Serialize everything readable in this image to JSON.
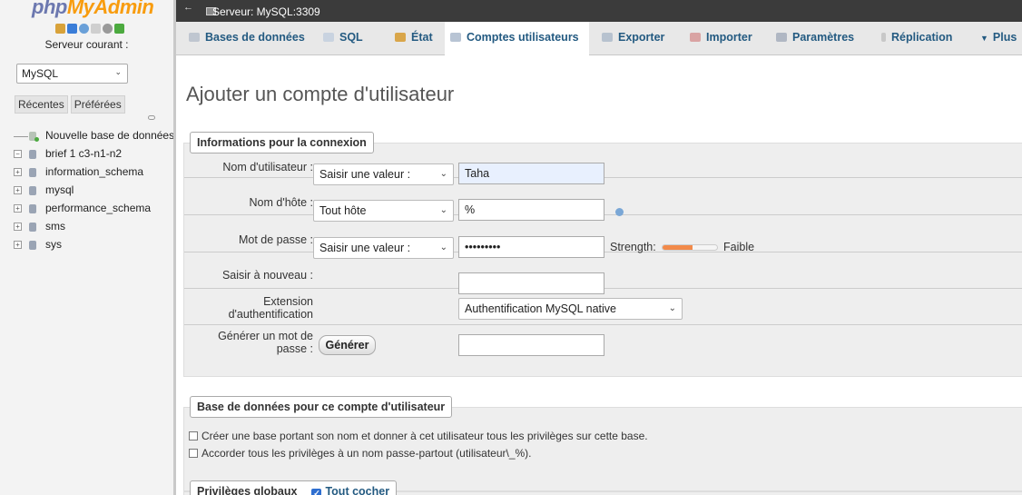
{
  "sidebar": {
    "logo_php": "php",
    "logo_myadmin": "MyAdmin",
    "server_label": "Serveur courant :",
    "server_value": "MySQL",
    "recent_tab": "Récentes",
    "favorites_tab": "Préférées",
    "tree": [
      {
        "label": "Nouvelle base de données",
        "type": "new"
      },
      {
        "label": "brief 1 c3-n1-n2",
        "type": "db",
        "expanded": true
      },
      {
        "label": "information_schema",
        "type": "db"
      },
      {
        "label": "mysql",
        "type": "db"
      },
      {
        "label": "performance_schema",
        "type": "db"
      },
      {
        "label": "sms",
        "type": "db"
      },
      {
        "label": "sys",
        "type": "db"
      }
    ]
  },
  "topbar": {
    "server": "Serveur: MySQL:3309"
  },
  "tabs": [
    {
      "label": "Bases de données",
      "icon": "database-icon"
    },
    {
      "label": "SQL",
      "icon": "sql-icon"
    },
    {
      "label": "État",
      "icon": "status-icon"
    },
    {
      "label": "Comptes utilisateurs",
      "icon": "users-icon",
      "active": true
    },
    {
      "label": "Exporter",
      "icon": "export-icon"
    },
    {
      "label": "Importer",
      "icon": "import-icon"
    },
    {
      "label": "Paramètres",
      "icon": "settings-icon"
    },
    {
      "label": "Réplication",
      "icon": "replication-icon"
    },
    {
      "label": "Plus",
      "icon": "more-icon"
    }
  ],
  "page": {
    "title": "Ajouter un compte d'utilisateur"
  },
  "login_info": {
    "legend": "Informations pour la connexion",
    "username_label": "Nom d'utilisateur :",
    "username_mode": "Saisir une valeur :",
    "username_value": "Taha",
    "host_label": "Nom d'hôte :",
    "host_mode": "Tout hôte",
    "host_value": "%",
    "password_label": "Mot de passe :",
    "password_mode": "Saisir une valeur :",
    "password_value": "•••••••••",
    "strength_label": "Strength:",
    "strength_level": 0.55,
    "strength_text": "Faible",
    "retype_label": "Saisir à nouveau :",
    "auth_label_1": "Extension",
    "auth_label_2": "d'authentification",
    "auth_value": "Authentification MySQL native",
    "gen_label_1": "Générer un mot de",
    "gen_label_2": "passe :",
    "gen_button": "Générer"
  },
  "database_section": {
    "legend": "Base de données pour ce compte d'utilisateur",
    "option_1": "Créer une base portant son nom et donner à cet utilisateur tous les privilèges sur cette base.",
    "option_2": "Accorder tous les privilèges à un nom passe-partout (utilisateur\\_%)."
  },
  "global_privileges": {
    "legend": "Privilèges globaux",
    "check_all": "Tout cocher"
  },
  "colors": {
    "link_blue": "#235a81",
    "topbar_bg": "#3b3b3b",
    "strength_orange": "#f28a4a"
  }
}
